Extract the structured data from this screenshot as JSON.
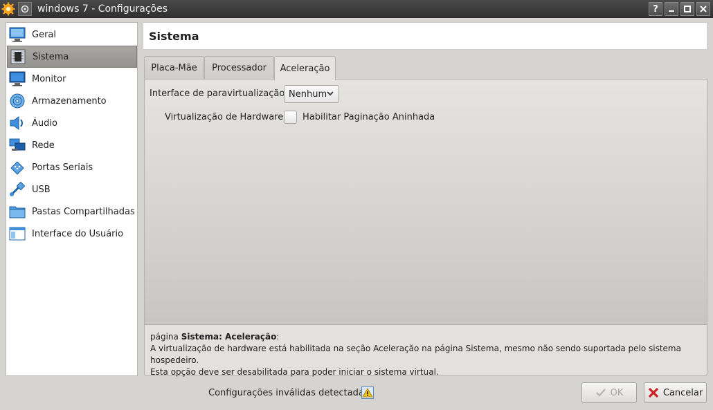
{
  "window": {
    "title": "windows 7 - Configurações",
    "buttons": [
      "?",
      "–",
      "□",
      "✕"
    ]
  },
  "sidebar": {
    "items": [
      {
        "label": "Geral",
        "icon": "monitor-general-icon"
      },
      {
        "label": "Sistema",
        "icon": "chip-icon",
        "selected": true
      },
      {
        "label": "Monitor",
        "icon": "display-icon"
      },
      {
        "label": "Armazenamento",
        "icon": "disk-icon"
      },
      {
        "label": "Áudio",
        "icon": "speaker-icon"
      },
      {
        "label": "Rede",
        "icon": "network-icon"
      },
      {
        "label": "Portas Seriais",
        "icon": "serial-port-icon"
      },
      {
        "label": "USB",
        "icon": "usb-icon"
      },
      {
        "label": "Pastas Compartilhadas",
        "icon": "folder-icon"
      },
      {
        "label": "Interface do Usuário",
        "icon": "user-interface-icon"
      }
    ]
  },
  "header": {
    "title": "Sistema"
  },
  "tabs": [
    {
      "label": "Placa-Mãe"
    },
    {
      "label": "Processador"
    },
    {
      "label": "Aceleração",
      "active": true
    }
  ],
  "acceleration": {
    "paravirt_label": "Interface de paravirtualização:",
    "paravirt_value": "Nenhum",
    "hw_virt_label": "Virtualização de Hardware:",
    "nested_paging_label": "Habilitar Paginação Aninhada",
    "nested_paging_checked": false
  },
  "info": {
    "prefix": "página ",
    "page": "Sistema: Aceleração",
    "suffix": ":",
    "line1": "A virtualização de hardware está habilitada na seção Aceleração na página Sistema, mesmo não sendo suportada pelo sistema hospedeiro.",
    "line2": "Esta opção deve ser desabilitada para poder iniciar o sistema virtual."
  },
  "footer": {
    "invalid_text": "Configurações inválidas detectadas",
    "ok_label": "OK",
    "cancel_label": "Cancelar"
  },
  "colors": {
    "titlebar": "#3a3a3a",
    "selected_item": "#a09e9b",
    "accent_blue": "#1a6fbf",
    "cancel_red": "#d22020"
  }
}
